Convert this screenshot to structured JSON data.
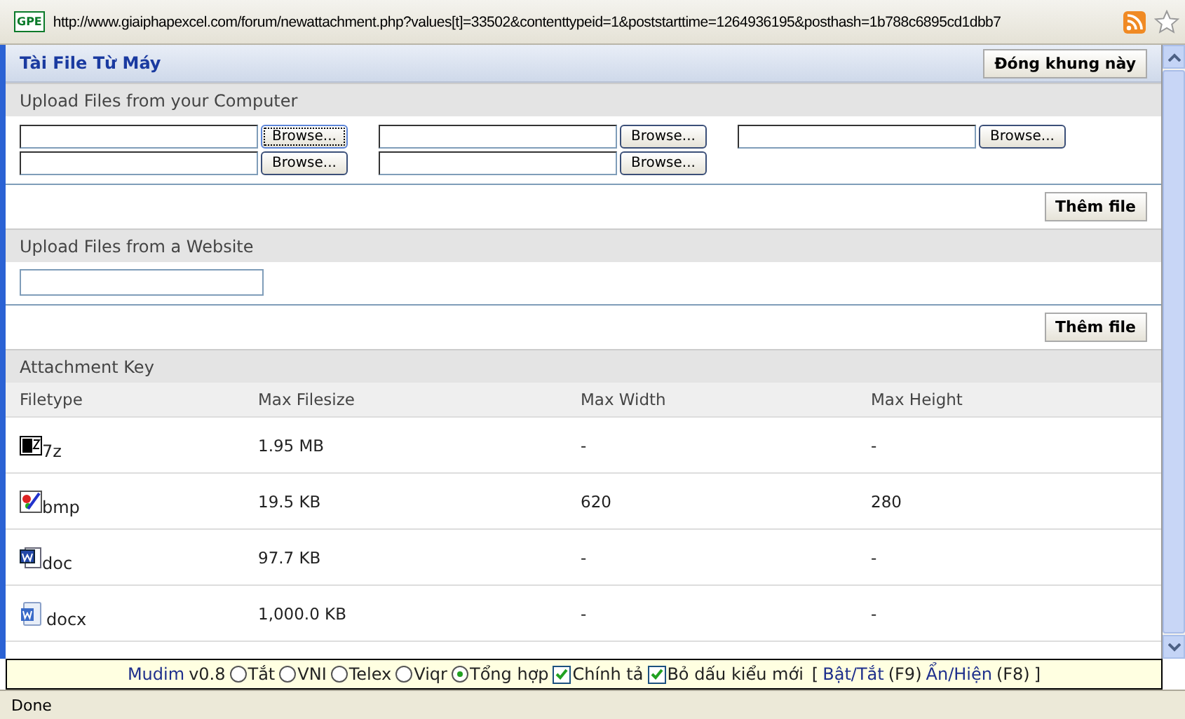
{
  "address_bar": {
    "site_badge": "GPE",
    "url": "http://www.giaiphapexcel.com/forum/newattachment.php?values[t]=33502&contenttypeid=1&poststarttime=1264936195&posthash=1b788c6895cd1dbb7"
  },
  "dialog": {
    "title": "Tài File Từ Máy",
    "close_button": "Đóng khung này"
  },
  "computer_upload": {
    "heading": "Upload Files from your Computer",
    "rows": [
      [
        {
          "button": "Browse...",
          "focused": true
        },
        {
          "button": "Browse...",
          "focused": false
        },
        {
          "button": "Browse...",
          "focused": false
        }
      ],
      [
        {
          "button": "Browse...",
          "focused": false
        },
        {
          "button": "Browse...",
          "focused": false
        }
      ]
    ],
    "add_button": "Thêm file"
  },
  "website_upload": {
    "heading": "Upload Files from a Website",
    "add_button": "Thêm file"
  },
  "attachment_key": {
    "heading": "Attachment Key",
    "columns": [
      "Filetype",
      "Max Filesize",
      "Max Width",
      "Max Height"
    ],
    "rows": [
      {
        "kind": "archive",
        "cells": [
          "7z",
          "1.95 MB",
          "-",
          "-"
        ]
      },
      {
        "kind": "image",
        "cells": [
          "bmp",
          "19.5 KB",
          "620",
          "280"
        ]
      },
      {
        "kind": "document",
        "cells": [
          "doc",
          "97.7 KB",
          "-",
          "-"
        ]
      },
      {
        "kind": "document-new",
        "cells": [
          "docx",
          "1,000.0 KB",
          "-",
          "-"
        ]
      }
    ]
  },
  "mudim": {
    "name": "Mudim",
    "version": "v0.8",
    "options": [
      {
        "label": "Tắt",
        "selected": false
      },
      {
        "label": "VNI",
        "selected": false
      },
      {
        "label": "Telex",
        "selected": false
      },
      {
        "label": "Viqr",
        "selected": false
      },
      {
        "label": "Tổng hợp",
        "selected": true
      }
    ],
    "checks": [
      {
        "label": "Chính tả",
        "checked": true
      },
      {
        "label": "Bỏ dấu kiểu mới",
        "checked": true
      }
    ],
    "bracket_open": "[",
    "toggle_link": "Bật/Tắt",
    "toggle_key": "(F9)",
    "show_link": "Ẩn/Hiện",
    "show_key": "(F8)",
    "bracket_close": "]"
  },
  "status_bar": {
    "text": "Done"
  }
}
